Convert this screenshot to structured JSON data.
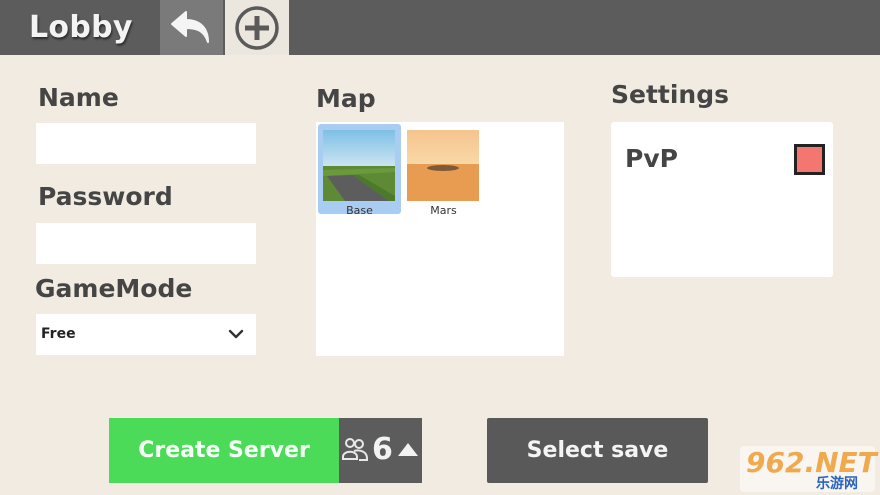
{
  "header": {
    "title": "Lobby",
    "back_icon": "back-arrow-icon",
    "add_icon": "plus-circle-icon"
  },
  "form": {
    "name_label": "Name",
    "name_value": "",
    "password_label": "Password",
    "password_value": "",
    "gamemode_label": "GameMode",
    "gamemode_selected": "Free"
  },
  "map": {
    "label": "Map",
    "items": [
      {
        "name": "Base",
        "selected": true
      },
      {
        "name": "Mars",
        "selected": false
      }
    ]
  },
  "settings": {
    "label": "Settings",
    "pvp_label": "PvP",
    "pvp_enabled": false
  },
  "footer": {
    "create_label": "Create Server",
    "player_count": "6",
    "select_save_label": "Select save"
  },
  "watermark": {
    "top": "962.NET",
    "bottom": "乐游网"
  },
  "colors": {
    "background": "#f1ebe1",
    "topbar": "#5c5c5c",
    "create_button": "#4cdb59",
    "selected_map": "#a9cdf2",
    "pvp_toggle": "#f47670"
  }
}
